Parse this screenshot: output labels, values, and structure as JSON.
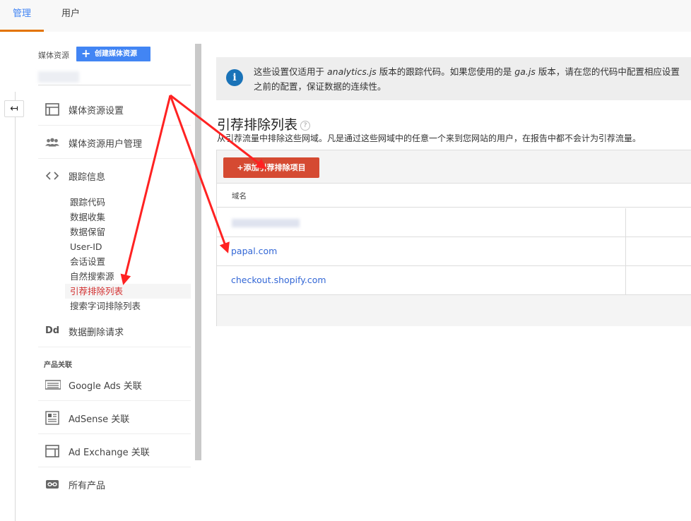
{
  "tabs": [
    {
      "label": "管理"
    },
    {
      "label": "用户"
    }
  ],
  "back_glyph": "↤",
  "sidebar": {
    "property_label": "媒体资源",
    "create_button": "创建媒体资源",
    "items": [
      {
        "label": "媒体资源设置",
        "icon": "layout-icon"
      },
      {
        "label": "媒体资源用户管理",
        "icon": "people-icon"
      },
      {
        "label": "跟踪信息",
        "icon": "code-icon"
      }
    ],
    "tracking_sub_items": [
      {
        "label": "跟踪代码"
      },
      {
        "label": "数据收集"
      },
      {
        "label": "数据保留"
      },
      {
        "label": "User-ID"
      },
      {
        "label": "会话设置"
      },
      {
        "label": "自然搜索源"
      },
      {
        "label": "引荐排除列表"
      },
      {
        "label": "搜索字词排除列表"
      }
    ],
    "data_delete": {
      "label": "数据删除请求",
      "icon_text": "Dd"
    },
    "section_product_links": "产品关联",
    "product_links": [
      {
        "label": "Google Ads 关联",
        "icon": "google-ads-icon"
      },
      {
        "label": "AdSense 关联",
        "icon": "adsense-icon"
      },
      {
        "label": "Ad Exchange 关联",
        "icon": "ad-exchange-icon"
      },
      {
        "label": "所有产品",
        "icon": "link-icon"
      }
    ]
  },
  "info": {
    "text_1": "这些设置仅适用于 ",
    "text_em_1": "analytics.js",
    "text_2": " 版本的跟踪代码。如果您使用的是 ",
    "text_em_2": "ga.js",
    "text_3": " 版本，请在您的代码中配置相应设置",
    "text_line2": "之前的配置，保证数据的连续性。"
  },
  "main": {
    "title": "引荐排除列表",
    "help_glyph": "?",
    "description": "从引荐流量中排除这些网域。凡是通过这些网域中的任意一个来到您网站的用户，在报告中都不会计为引荐流量。",
    "add_button": "+添加引荐排除项目",
    "column_domain": "域名",
    "rows": [
      {
        "domain": ""
      },
      {
        "domain": "papal.com"
      },
      {
        "domain": "checkout.shopify.com"
      }
    ]
  }
}
